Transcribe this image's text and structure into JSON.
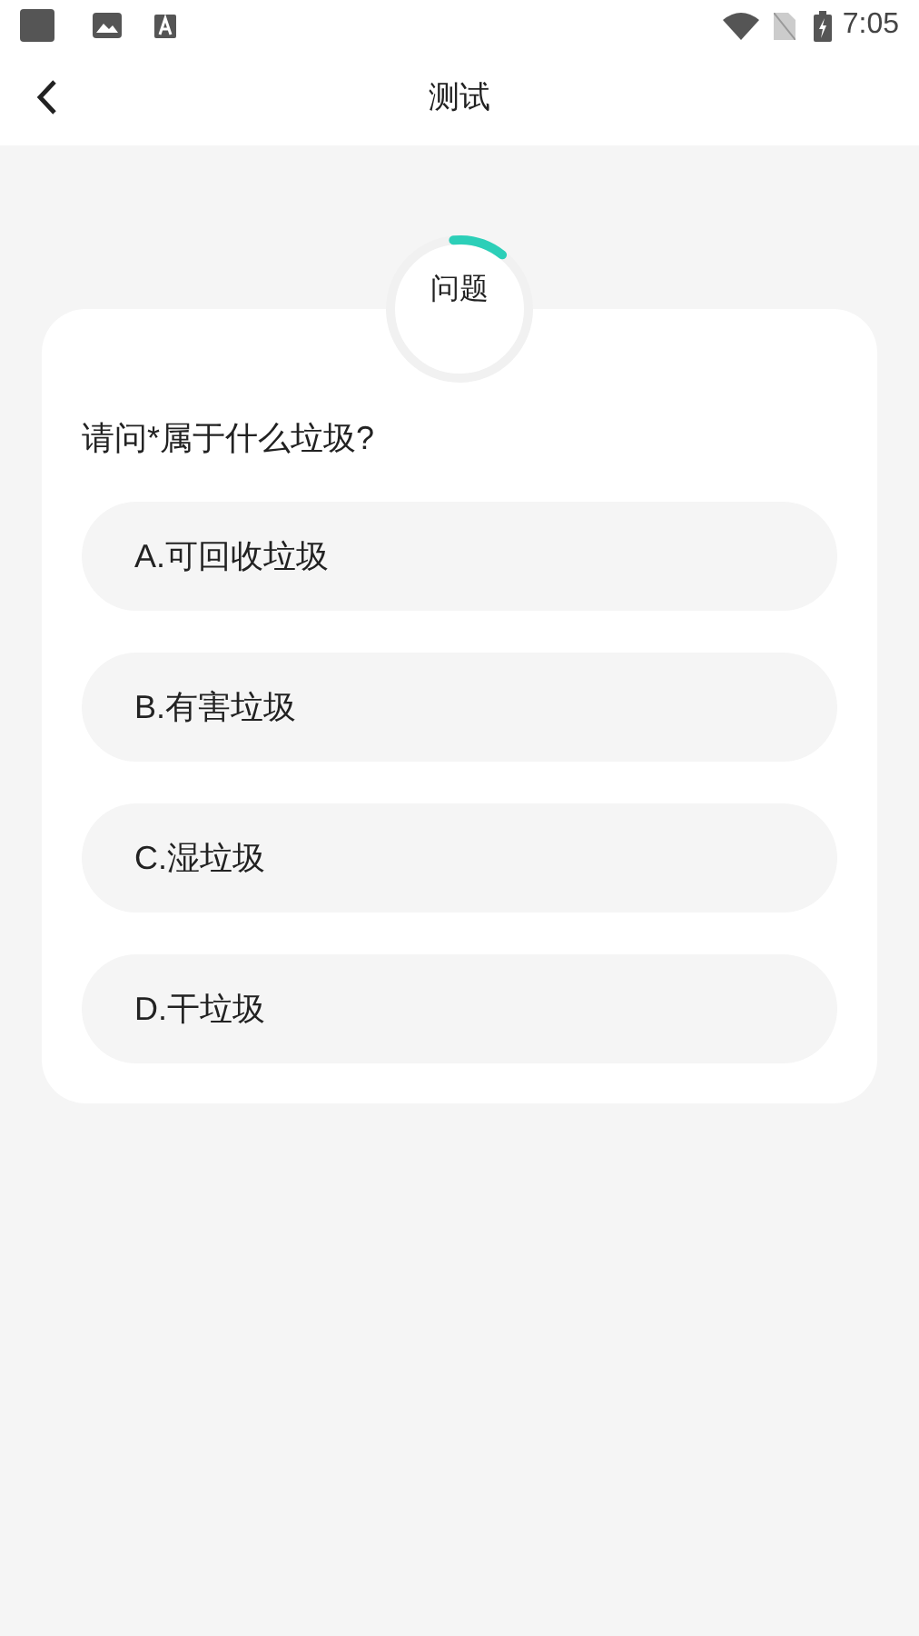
{
  "status_bar": {
    "time": "7:05"
  },
  "header": {
    "title": "测试"
  },
  "quiz": {
    "badge": "问题",
    "level": 0.12,
    "question": "请问*属于什么垃圾?",
    "options": [
      {
        "label": "A.可回收垃圾",
        "selected": false
      },
      {
        "label": "B.有害垃圾",
        "selected": false
      },
      {
        "label": "C.湿垃圾",
        "selected": false
      },
      {
        "label": "D.干垃圾",
        "selected": false
      }
    ]
  }
}
